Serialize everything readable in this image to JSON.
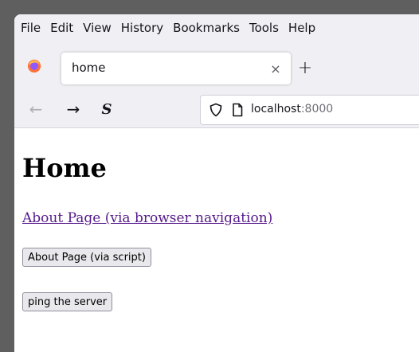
{
  "menu": [
    "File",
    "Edit",
    "View",
    "History",
    "Bookmarks",
    "Tools",
    "Help"
  ],
  "tab": {
    "title": "home",
    "close_glyph": "×"
  },
  "new_tab_glyph": "+",
  "nav": {
    "back_glyph": "←",
    "forward_glyph": "→",
    "extension_glyph": "S"
  },
  "url": {
    "host": "localhost",
    "port": ":8000"
  },
  "page": {
    "heading": "Home",
    "link_text": "About Page (via browser navigation)",
    "button_script": "About Page (via script)",
    "button_ping": "ping the server"
  },
  "colors": {
    "link": "#551a8b",
    "chrome": "#f0f0f4"
  },
  "icons": [
    "firefox-logo-icon",
    "close-icon",
    "plus-icon",
    "back-arrow-icon",
    "forward-arrow-icon",
    "extension-icon",
    "shield-icon",
    "page-icon"
  ]
}
